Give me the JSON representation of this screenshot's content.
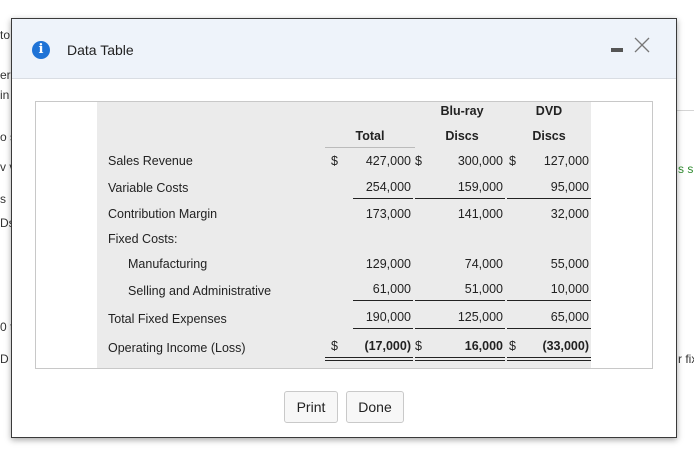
{
  "background": {
    "fragments": [
      "to",
      "er",
      "in",
      "o s",
      "v v",
      "s",
      "Ds",
      "0 t",
      "D",
      "s s",
      "r fix"
    ]
  },
  "modal": {
    "title": "Data Table",
    "icon": "info-icon",
    "controls": {
      "minimize": "minimize-icon",
      "close": "close-icon"
    }
  },
  "table": {
    "header": {
      "row1": {
        "bluray": "Blu-ray",
        "dvd": "DVD"
      },
      "row2": {
        "total": "Total",
        "bluray": "Discs",
        "dvd": "Discs"
      }
    },
    "rows": [
      {
        "label": "Sales Revenue",
        "cur1": "$",
        "total": "427,000",
        "cur2": "$",
        "bluray": "300,000",
        "cur3": "$",
        "dvd": "127,000"
      },
      {
        "label": "Variable Costs",
        "total": "254,000",
        "bluray": "159,000",
        "dvd": "95,000"
      },
      {
        "label": "Contribution Margin",
        "total": "173,000",
        "bluray": "141,000",
        "dvd": "32,000"
      },
      {
        "label": "Fixed Costs:"
      },
      {
        "label": "Manufacturing",
        "total": "129,000",
        "bluray": "74,000",
        "dvd": "55,000"
      },
      {
        "label": "Selling and Administrative",
        "total": "61,000",
        "bluray": "51,000",
        "dvd": "10,000"
      },
      {
        "label": "Total Fixed Expenses",
        "total": "190,000",
        "bluray": "125,000",
        "dvd": "65,000"
      },
      {
        "label": "Operating Income (Loss)",
        "cur1": "$",
        "total": "(17,000)",
        "cur2": "$",
        "bluray": "16,000",
        "cur3": "$",
        "dvd": "(33,000)"
      }
    ]
  },
  "buttons": {
    "print": "Print",
    "done": "Done"
  }
}
